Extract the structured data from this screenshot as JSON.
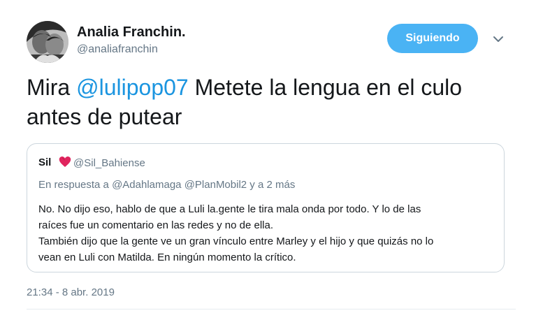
{
  "author": {
    "name": "Analia Franchin.",
    "handle": "@analiafranchin"
  },
  "follow_button": {
    "label": "Siguiendo"
  },
  "icons": {
    "menu": "chevron-down-icon",
    "quote_author_badge": "red-heart-icon"
  },
  "colors": {
    "accent": "#1b95e0",
    "follow_button": "#4ab3f4",
    "secondary_text": "#657786"
  },
  "tweet": {
    "prefix": "Mira ",
    "mention": "@lulipop07",
    "line1_rest": " Metete la lengua en el culo",
    "line2": "antes de putear"
  },
  "quoted_tweet": {
    "name": "Sil",
    "handle": "@Sil_Bahiense",
    "reply_line": "En respuesta a @Adahlamaga @PlanMobil2 y a 2 más",
    "body_lines": [
      "No. No dijo eso, hablo de que a Luli la.gente le tira mala onda por todo. Y lo de las",
      "raíces fue un comentario en las redes y no de ella.",
      "También dijo que la gente ve un gran vínculo entre Marley y el hijo y que quizás no lo",
      "vean en Luli con Matilda. En ningún momento la crítico."
    ]
  },
  "timestamp": "21:34 - 8 abr. 2019"
}
